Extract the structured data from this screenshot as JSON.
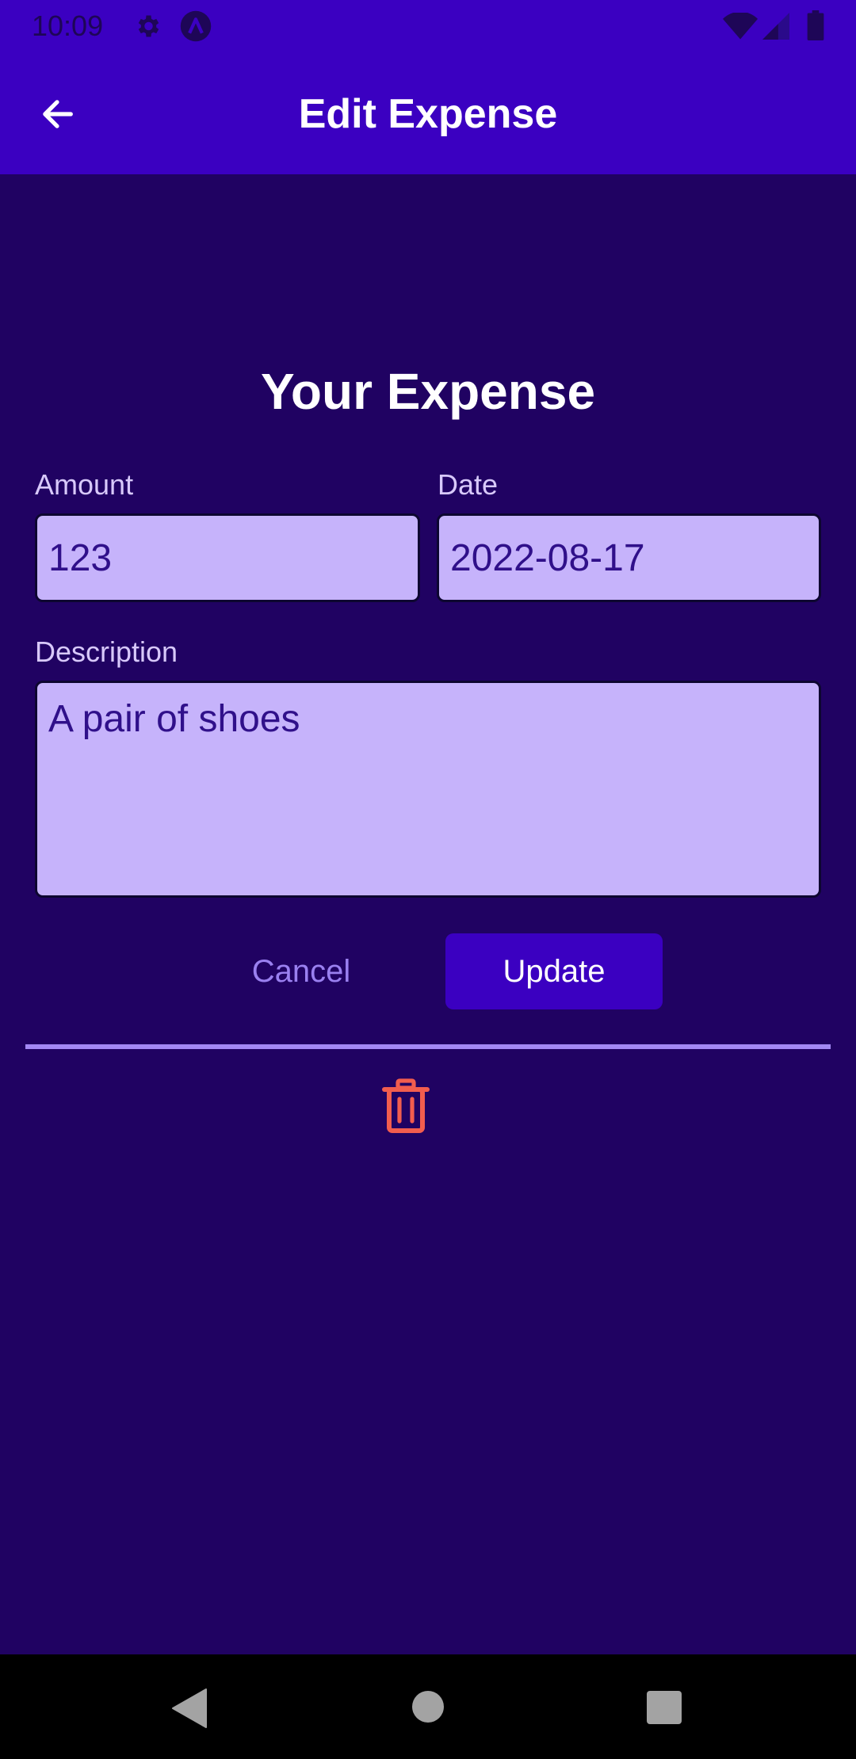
{
  "status_bar": {
    "time": "10:09",
    "icons": [
      "gear-icon",
      "app-notification-icon",
      "wifi-icon",
      "signal-icon",
      "battery-icon"
    ]
  },
  "app_bar": {
    "title": "Edit Expense",
    "back_icon": "arrow-left-icon"
  },
  "form": {
    "title": "Your Expense",
    "amount": {
      "label": "Amount",
      "value": "123"
    },
    "date": {
      "label": "Date",
      "value": "2022-08-17"
    },
    "description": {
      "label": "Description",
      "value": "A pair of shoes"
    },
    "cancel_label": "Cancel",
    "update_label": "Update",
    "delete_icon": "trash-icon"
  },
  "nav_bar": {
    "icons": [
      "back-triangle-icon",
      "home-circle-icon",
      "recents-square-icon"
    ]
  },
  "colors": {
    "background": "#200262",
    "primary": "#3b00c1",
    "input_background": "#c6b3fb",
    "input_text": "#30108a",
    "accent": "#a388f4",
    "danger": "#f25d4e"
  }
}
